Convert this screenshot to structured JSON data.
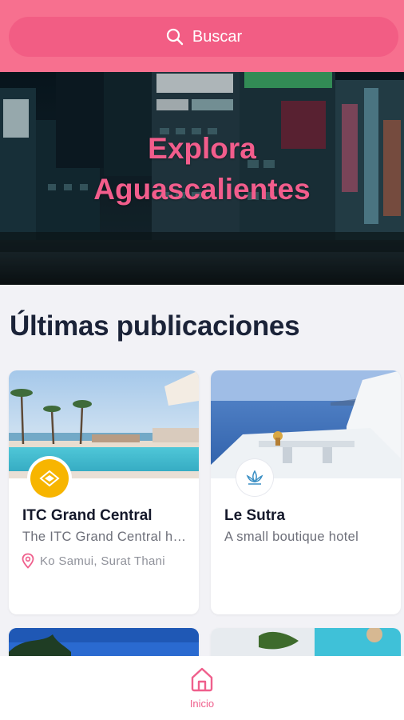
{
  "search": {
    "label": "Buscar",
    "icon": "search-icon"
  },
  "hero": {
    "line1": "Explora",
    "line2": "Aguascalientes"
  },
  "section": {
    "title": "Últimas publicaciones"
  },
  "listings": [
    {
      "title": "ITC Grand Central",
      "description": "The ITC Grand Central hotel",
      "location": "Ko Samui, Surat Thani",
      "logo_icon": "hotel-logo-icon",
      "logo_color": "#f7b500"
    },
    {
      "title": "Le Sutra",
      "description": "A small boutique hotel",
      "logo_icon": "lotus-logo-icon",
      "logo_color": "#3a8fc4"
    }
  ],
  "tabbar": {
    "home_label": "Inicio",
    "home_icon": "home-icon"
  },
  "colors": {
    "brand": "#f7708f",
    "accent": "#ef5f8c",
    "heading": "#1b2338"
  }
}
